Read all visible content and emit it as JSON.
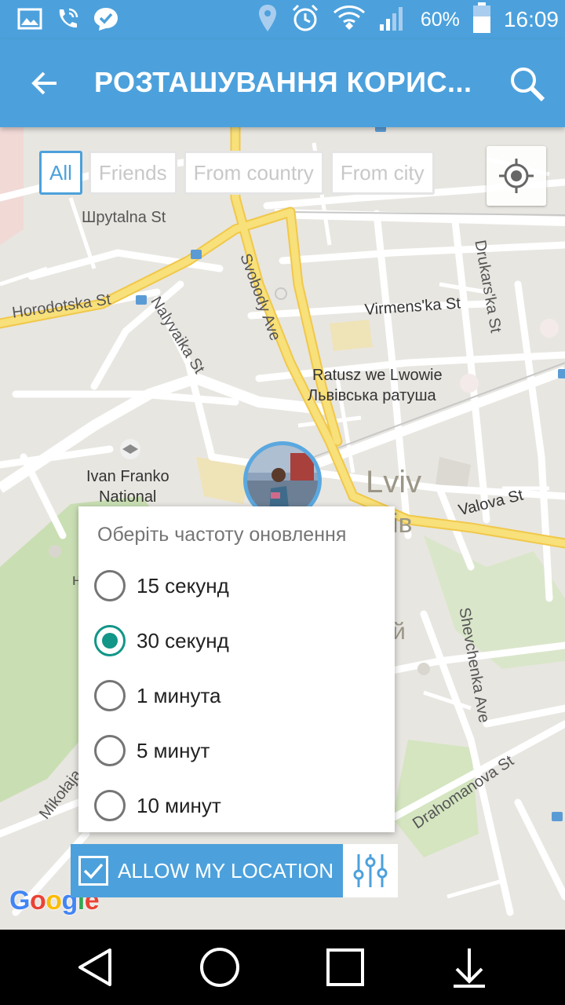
{
  "status_bar": {
    "battery": "60%",
    "time": "16:09",
    "icons": [
      "image-icon",
      "wifi-call-icon",
      "messenger-icon",
      "location-icon",
      "alarm-icon",
      "wifi-icon",
      "signal-icon",
      "battery-icon"
    ]
  },
  "app_bar": {
    "title": "РОЗТАШУВАННЯ КОРИС...",
    "back_icon": "arrow-back-icon",
    "search_icon": "search-icon"
  },
  "filters": {
    "items": [
      {
        "label": "All",
        "active": true
      },
      {
        "label": "Friends",
        "active": false
      },
      {
        "label": "From country",
        "active": false
      },
      {
        "label": "From city",
        "active": false
      }
    ]
  },
  "map": {
    "labels": {
      "shpytalna": "Шpytalna St",
      "horodotska": "Horodotska St",
      "nalyvaika": "Nalyvaika St",
      "svobody": "Svobody Ave",
      "drukarska": "Drukars'ka St",
      "virmenska": "Virmens'ka St",
      "ratusz1": "Ratusz we Lwowie",
      "ratusz2": "Львівська ратуша",
      "ivan1": "Ivan Franko",
      "ivan2": "National",
      "lviv": "Lviv",
      "lviv_uk": "ів",
      "valova": "Valova St",
      "shevchenka": "Shevchenka Ave",
      "drahomanova": "Drahomanova St",
      "mikolaja": "Mikołaja",
      "letter_n": "н",
      "letter_y": "й"
    },
    "provider": "Google"
  },
  "dialog": {
    "title": "Оберіть частоту оновлення",
    "options": [
      {
        "label": "15 секунд",
        "checked": false
      },
      {
        "label": "30 секунд",
        "checked": true
      },
      {
        "label": "1 минута",
        "checked": false
      },
      {
        "label": "5 минут",
        "checked": false
      },
      {
        "label": "10 минут",
        "checked": false
      }
    ]
  },
  "allow_location": {
    "label": "ALLOW MY LOCATION",
    "checked": true,
    "settings_icon": "equalizer-icon"
  },
  "colors": {
    "accent": "#4ca1dc",
    "radio_checked": "#119688",
    "road_major": "#f8d860"
  }
}
